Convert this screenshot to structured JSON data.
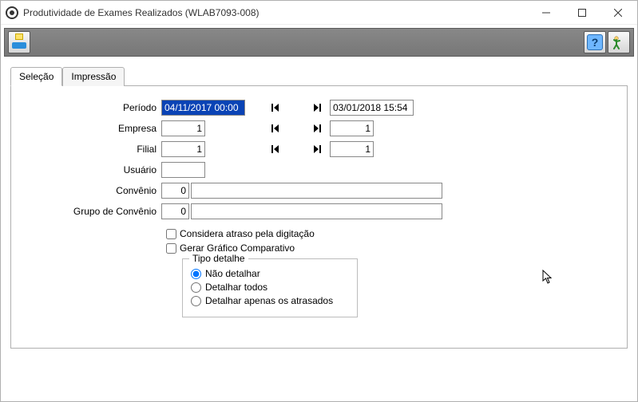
{
  "window": {
    "title": "Produtividade de Exames Realizados (WLAB7093-008)"
  },
  "tabs": [
    {
      "label": "Seleção",
      "active": true
    },
    {
      "label": "Impressão",
      "active": false
    }
  ],
  "form": {
    "periodo": {
      "label": "Período",
      "from": "04/11/2017 00:00",
      "to": "03/01/2018 15:54"
    },
    "empresa": {
      "label": "Empresa",
      "from": "1",
      "to": "1"
    },
    "filial": {
      "label": "Filial",
      "from": "1",
      "to": "1"
    },
    "usuario": {
      "label": "Usuário",
      "value": ""
    },
    "convenio": {
      "label": "Convênio",
      "code": "0",
      "desc": ""
    },
    "grupoConvenio": {
      "label": "Grupo de Convênio",
      "code": "0",
      "desc": ""
    }
  },
  "options": {
    "considera_atraso": {
      "label": "Considera atraso pela digitação",
      "checked": false
    },
    "gerar_grafico": {
      "label": "Gerar Gráfico Comparativo",
      "checked": false
    }
  },
  "detail": {
    "group_title": "Tipo detalhe",
    "items": [
      {
        "label": "Não detalhar",
        "checked": true
      },
      {
        "label": "Detalhar todos",
        "checked": false
      },
      {
        "label": "Detalhar apenas os atrasados",
        "checked": false
      }
    ]
  }
}
